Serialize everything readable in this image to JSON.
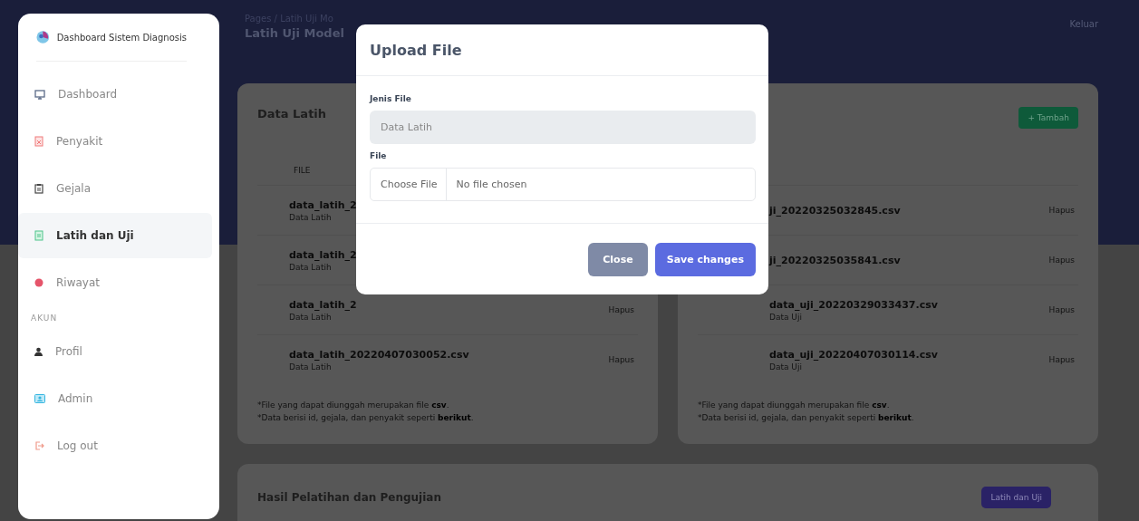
{
  "sidebar": {
    "brand": "Dashboard Sistem Diagnosis",
    "items": [
      {
        "label": "Dashboard",
        "selected": false
      },
      {
        "label": "Penyakit",
        "selected": false
      },
      {
        "label": "Gejala",
        "selected": false
      },
      {
        "label": "Latih dan Uji",
        "selected": true
      },
      {
        "label": "Riwayat",
        "selected": false
      }
    ],
    "section": "AKUN",
    "account_items": [
      {
        "label": "Profil",
        "selected": false
      },
      {
        "label": "Admin",
        "selected": false
      },
      {
        "label": "Log out",
        "selected": false
      }
    ]
  },
  "header": {
    "breadcrumb": "Pages / Latih Uji Mo",
    "title": "Latih Uji Model",
    "logout": "Keluar"
  },
  "cards": [
    {
      "title": "Data Latih",
      "column": "FILE",
      "rows": [
        {
          "name": "data_latih_2",
          "type": "Data Latih"
        },
        {
          "name": "data_latih_2",
          "type": "Data Latih"
        },
        {
          "name": "data_latih_2",
          "type": "Data Latih",
          "action": "Hapus"
        },
        {
          "name": "data_latih_20220407030052.csv",
          "type": "Data Latih",
          "action": "Hapus"
        }
      ],
      "notes": [
        "*File yang dapat diunggah merupakan file **csv**.",
        "*Data berisi id, gejala, dan penyakit seperti **berikut**."
      ]
    },
    {
      "button": "+ Tambah",
      "rows": [
        {
          "name": "ji_20220325032845.csv",
          "action": "Hapus"
        },
        {
          "name": "ji_20220325035841.csv",
          "action": "Hapus"
        },
        {
          "name": "data_uji_20220329033437.csv",
          "type": "Data Uji",
          "action": "Hapus"
        },
        {
          "name": "data_uji_20220407030114.csv",
          "type": "Data Uji",
          "action": "Hapus"
        }
      ],
      "notes": [
        "*File yang dapat diunggah merupakan file **csv**.",
        "*Data berisi id, gejala, dan penyakit seperti **berikut**."
      ]
    }
  ],
  "results": {
    "title": "Hasil Pelatihan dan Pengujian",
    "button": "Latih dan Uji"
  },
  "modal": {
    "title": "Upload File",
    "type_label": "Jenis File",
    "type_value": "Data Latih",
    "file_label": "File",
    "choose": "Choose File",
    "file_status": "No file chosen",
    "buttons": [
      {
        "label": "Close",
        "kind": "secondary"
      },
      {
        "label": "Save changes",
        "kind": "primary"
      }
    ]
  }
}
